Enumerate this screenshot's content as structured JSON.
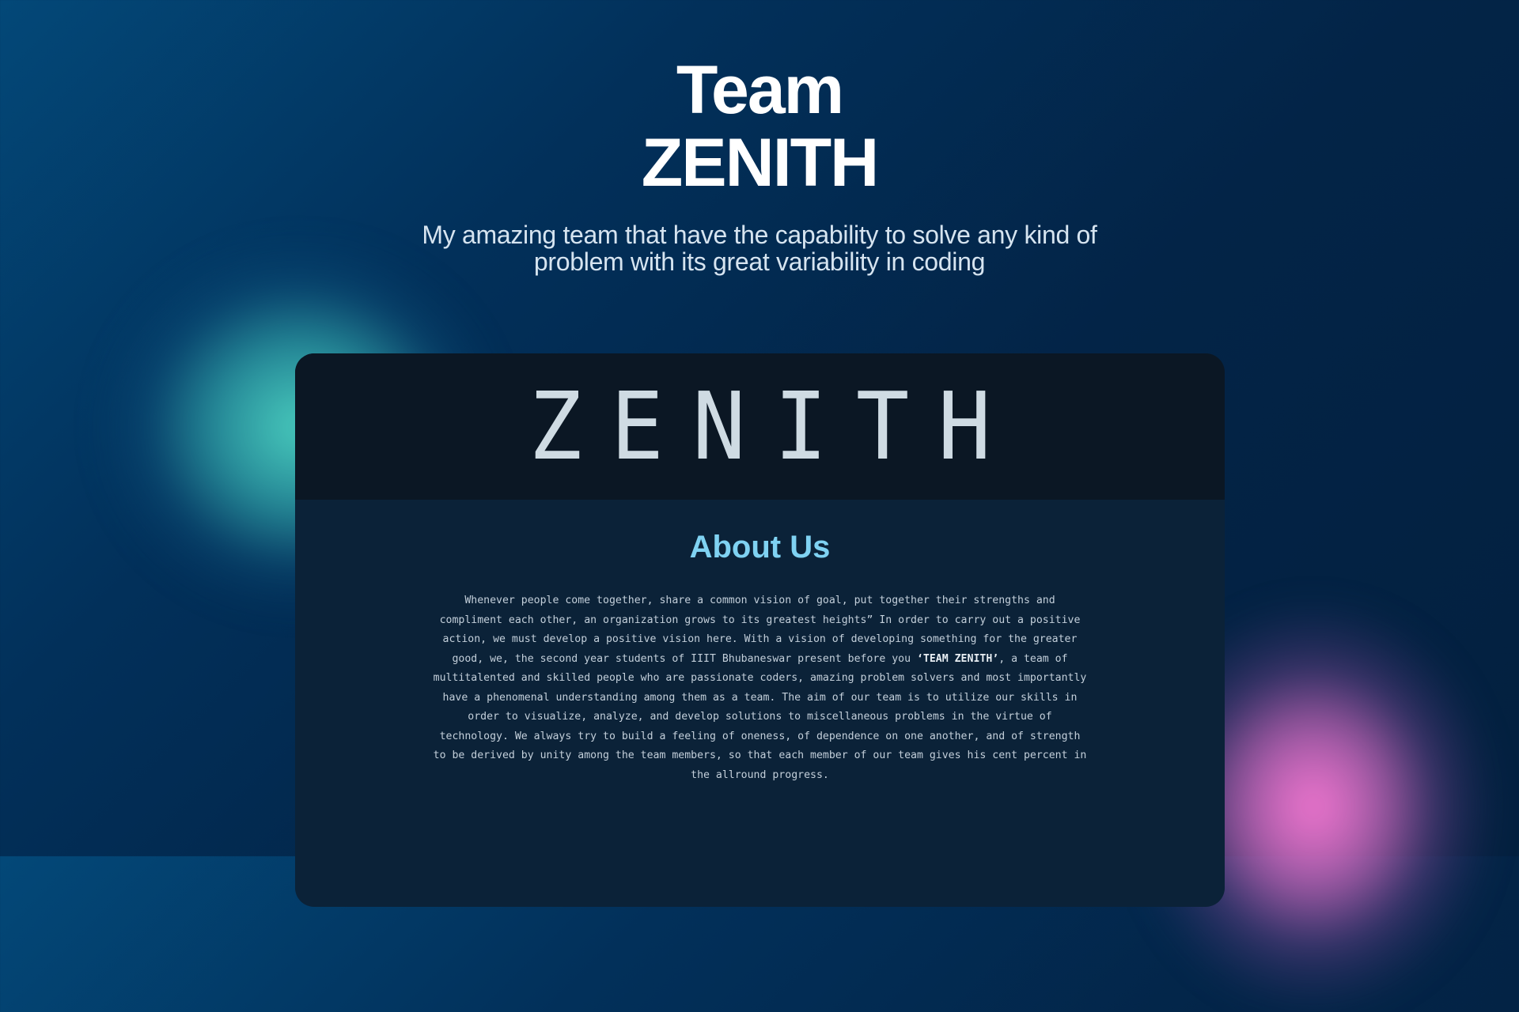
{
  "hero": {
    "title_line1": "Team",
    "title_line2": "ZENITH",
    "subtitle": "My amazing team that have the capability to solve any kind of problem with its great variability in coding"
  },
  "card": {
    "brand": "ZENITH",
    "about_heading": "About Us",
    "paragraph_before": "Whenever people come together, share a common vision of goal, put together their strengths and compliment each other, an organization grows to its greatest heights” In order to carry out a positive action, we must develop a positive vision here. With a vision of developing something for the greater good, we, the second year students of IIIT Bhubaneswar present before you ",
    "paragraph_bold": "‘TEAM ZENITH’",
    "paragraph_after": ", a team of multitalented and skilled people who are passionate coders, amazing problem solvers and most importantly have a phenomenal understanding among them as a team. The aim of our team is to utilize our skills in order to visualize, analyze, and develop solutions to miscellaneous problems in the virtue of technology. We always try to build a feeling of oneness, of dependence on one another, and of strength to be derived by unity among the team members, so that each member of our team gives his cent percent in the allround progress."
  },
  "colors": {
    "accent": "#7fd2f2",
    "teal_glow": "#4ed6c4",
    "pink_glow": "#f578d2",
    "card_bg": "#0b2238",
    "card_header": "#0b1724"
  }
}
